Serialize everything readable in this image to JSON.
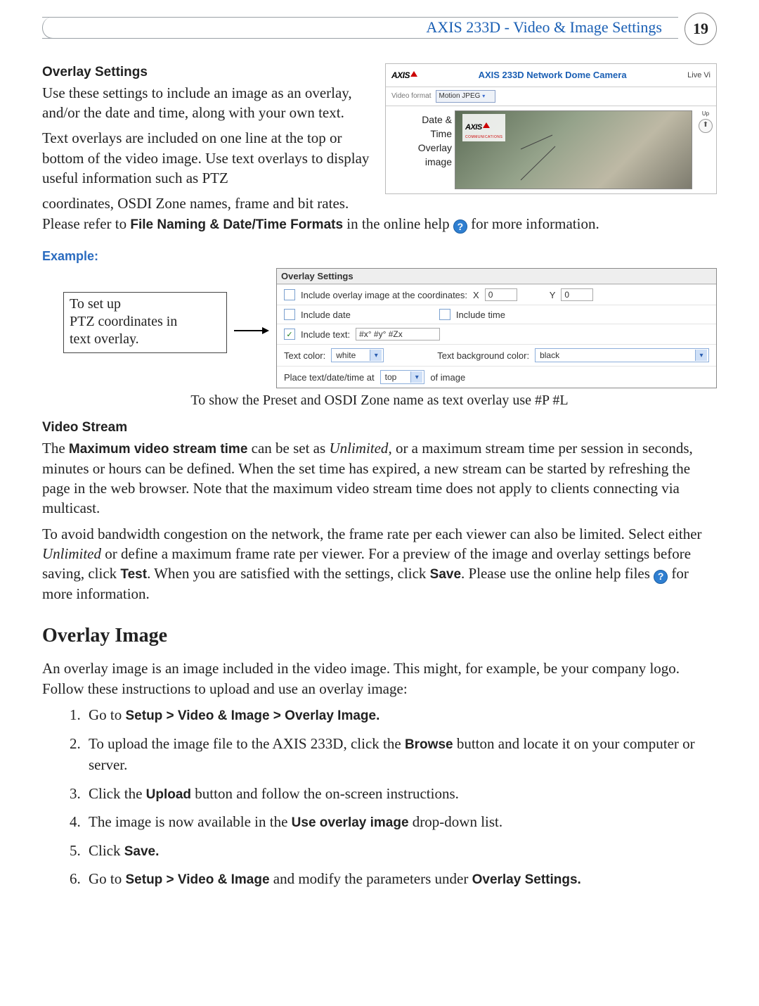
{
  "header": {
    "title": "AXIS 233D - Video & Image Settings",
    "page_number": "19"
  },
  "overlay_settings": {
    "title": "Overlay Settings",
    "p1": "Use these settings to include an image as an overlay, and/or the date and time, along with your own text.",
    "p2a": "Text overlays are included on one line at the top or bottom of the video image. Use text overlays to display useful information such as PTZ ",
    "p2b": "coordinates, OSDI Zone names, frame and bit rates. Please refer to ",
    "file_naming": "File Naming & Date/Time Formats",
    "p2c": " in the online help ",
    "p2d": " for more information."
  },
  "camera_fig": {
    "logo_text": "AXIS",
    "product_title": "AXIS 233D Network Dome Camera",
    "live_label": "Live Vi",
    "video_format_label": "Video format",
    "video_format_value": "Motion JPEG",
    "label_datetime_1": "Date &",
    "label_datetime_2": "Time",
    "label_overlay_1": "Overlay",
    "label_overlay_2": "image",
    "overlay_brand_small": "AXIS",
    "overlay_brand_sub": "COMMUNICATIONS",
    "up_label": "Up",
    "up_arrow_glyph": "⬆"
  },
  "example": {
    "heading": "Example:",
    "callout_l1": "To set up",
    "callout_l2": "PTZ coordinates in",
    "callout_l3": "text overlay.",
    "dialog_title": "Overlay Settings",
    "row1_label": "Include overlay image at the coordinates:",
    "row1_x_label": "X",
    "row1_x_val": "0",
    "row1_y_label": "Y",
    "row1_y_val": "0",
    "row2_date_label": "Include date",
    "row2_time_label": "Include time",
    "row3_label": "Include text:",
    "row3_value": "#x° #y° #Zx",
    "row4_tc_label": "Text color:",
    "row4_tc_value": "white",
    "row4_bg_label": "Text background color:",
    "row4_bg_value": "black",
    "row5_a": "Place text/date/time at",
    "row5_value": "top",
    "row5_b": "of image",
    "caption": "To show the Preset and OSDI Zone name as text overlay use #P #L"
  },
  "video_stream": {
    "title": "Video Stream",
    "p1a": "The ",
    "max_bold": "Maximum video stream time",
    "p1b": " can be set as ",
    "unlimited": "Unlimited",
    "p1c": ", or a maximum stream time per session in seconds, minutes or hours can be defined. When the set time has expired, a new stream can be started by refreshing the page in the web browser. Note that the maximum video stream time does not apply to clients connecting via multicast.",
    "p2a": "To avoid bandwidth congestion on the network, the frame rate per each viewer can also be limited. Select either ",
    "p2b": " or define a maximum frame rate per viewer. For a preview of the image and overlay settings before saving, click ",
    "test_bold": "Test",
    "p2c": ". When you are satisfied with the settings, click ",
    "save_bold": "Save",
    "p2d": ". Please use the online help files ",
    "p2e": " for more information."
  },
  "overlay_image": {
    "heading": "Overlay Image",
    "intro": "An overlay image is an image included in the video image. This might, for example, be your company logo. Follow these instructions to upload and use an overlay image:",
    "s1a": "Go to ",
    "s1b": "Setup > Video & Image > Overlay Image.",
    "s2a": "To upload the image file to the AXIS 233D, click the ",
    "s2b": "Browse",
    "s2c": " button and locate it on your computer or server.",
    "s3a": "Click the ",
    "s3b": "Upload",
    "s3c": " button and follow the on-screen instructions.",
    "s4a": "The image is now available in the ",
    "s4b": "Use overlay image",
    "s4c": " drop-down list.",
    "s5a": "Click ",
    "s5b": "Save.",
    "s6a": "Go to ",
    "s6b": "Setup > Video & Image",
    "s6c": " and modify the parameters under ",
    "s6d": "Overlay Settings."
  },
  "glyphs": {
    "help_q": "?",
    "check": "✓",
    "dd": "▾",
    "arrow_right": "►"
  }
}
